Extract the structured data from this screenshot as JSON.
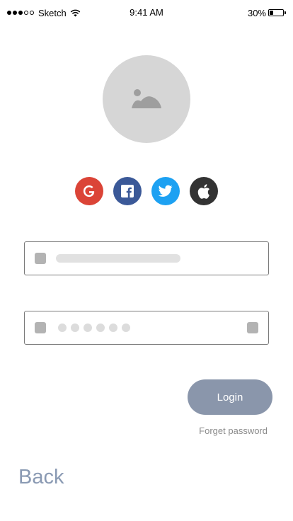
{
  "status_bar": {
    "carrier": "Sketch",
    "time": "9:41 AM",
    "battery": "30%",
    "battery_level": 0.3,
    "signal_bars_filled": 3,
    "signal_bars_total": 5
  },
  "profile": {
    "icon": "image-placeholder-icon"
  },
  "social": [
    {
      "name": "google",
      "glyph": "G",
      "color": "#db4437"
    },
    {
      "name": "facebook",
      "glyph": "f",
      "color": "#3b5998"
    },
    {
      "name": "twitter",
      "glyph": "twitter-bird",
      "color": "#1da1f2"
    },
    {
      "name": "apple",
      "glyph": "apple",
      "color": "#333333"
    }
  ],
  "form": {
    "username": {
      "icon": "field-icon",
      "value": ""
    },
    "password": {
      "masked_dots": 6,
      "icon": "field-icon",
      "trailing_icon": "show-password-icon"
    }
  },
  "actions": {
    "login": "Login",
    "forgot": "Forget password",
    "back": "Back"
  },
  "colors": {
    "login_bg": "#8a96ab",
    "back_text": "#8a9ab3",
    "avatar_bg": "#d6d6d6",
    "placeholder": "#b3b3b3"
  }
}
